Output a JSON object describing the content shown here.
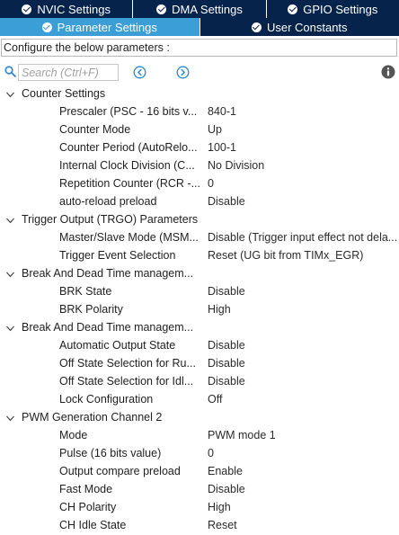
{
  "tabs_top": [
    {
      "label": "NVIC Settings"
    },
    {
      "label": "DMA Settings"
    },
    {
      "label": "GPIO Settings"
    }
  ],
  "tabs_second": [
    {
      "label": "Parameter Settings",
      "active": true
    },
    {
      "label": "User Constants",
      "active": false
    }
  ],
  "config_label": "Configure the below parameters :",
  "search": {
    "placeholder": "Search (Ctrl+F)"
  },
  "colors": {
    "tab_dark": "#05234b",
    "tab_active": "#3c9ed6",
    "nav_blue": "#2a86d2"
  },
  "groups": [
    {
      "title": "Counter Settings",
      "params": [
        {
          "name": "Prescaler (PSC - 16 bits v...",
          "value": "840-1"
        },
        {
          "name": "Counter Mode",
          "value": "Up"
        },
        {
          "name": "Counter Period (AutoRelo...",
          "value": "100-1"
        },
        {
          "name": "Internal Clock Division (C...",
          "value": "No Division"
        },
        {
          "name": "Repetition Counter (RCR -...",
          "value": "0"
        },
        {
          "name": "auto-reload preload",
          "value": "Disable"
        }
      ]
    },
    {
      "title": "Trigger Output (TRGO) Parameters",
      "params": [
        {
          "name": "Master/Slave Mode (MSM...",
          "value": "Disable (Trigger input effect not dela..."
        },
        {
          "name": "Trigger Event Selection",
          "value": "Reset (UG bit from TIMx_EGR)"
        }
      ]
    },
    {
      "title": "Break And Dead Time managem...",
      "params": [
        {
          "name": "BRK State",
          "value": "Disable"
        },
        {
          "name": "BRK Polarity",
          "value": "High"
        }
      ]
    },
    {
      "title": "Break And Dead Time managem...",
      "params": [
        {
          "name": "Automatic Output State",
          "value": "Disable"
        },
        {
          "name": "Off State Selection for Ru...",
          "value": "Disable"
        },
        {
          "name": "Off State Selection for Idl...",
          "value": "Disable"
        },
        {
          "name": "Lock Configuration",
          "value": "Off"
        }
      ]
    },
    {
      "title": "PWM Generation Channel 2",
      "params": [
        {
          "name": "Mode",
          "value": "PWM mode 1"
        },
        {
          "name": "Pulse (16 bits value)",
          "value": "0"
        },
        {
          "name": "Output compare preload",
          "value": "Enable"
        },
        {
          "name": "Fast Mode",
          "value": "Disable"
        },
        {
          "name": "CH Polarity",
          "value": "High"
        },
        {
          "name": "CH Idle State",
          "value": "Reset"
        }
      ]
    }
  ]
}
